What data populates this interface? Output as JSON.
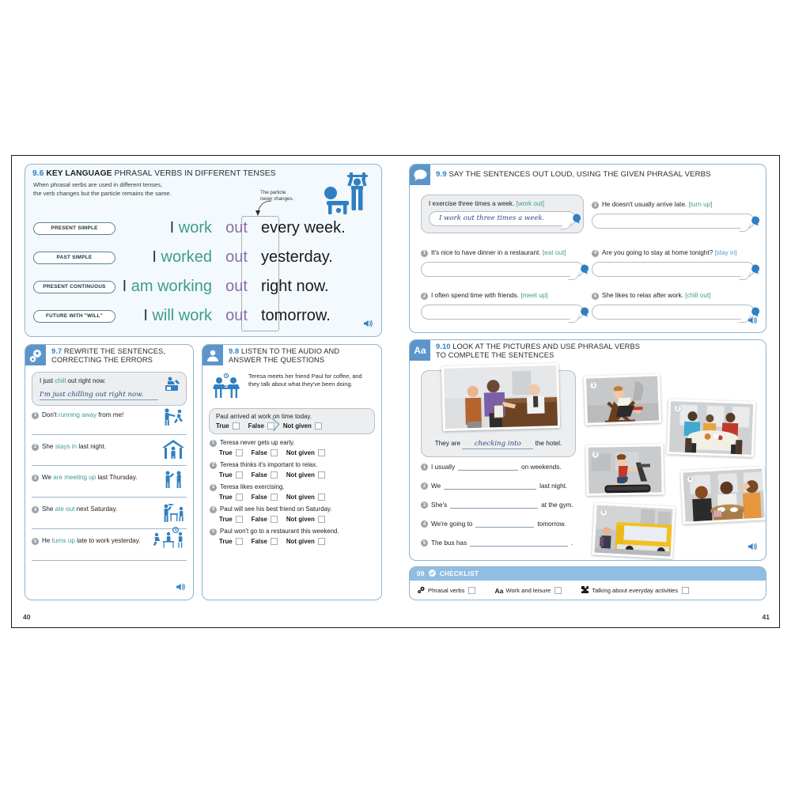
{
  "book": {
    "page_left": "40",
    "page_right": "41",
    "accent_blue": "#5b95c9",
    "verb_green": "#3f9c8d",
    "particle_purple": "#8b6fa8",
    "heading_blue": "#2f7fc0"
  },
  "key_language": {
    "number": "9.6",
    "label": "KEY LANGUAGE",
    "title": "PHRASAL VERBS IN DIFFERENT TENSES",
    "subtitle_line1": "When phrasal verbs are used in different tenses,",
    "subtitle_line2": "the verb changes but the particle remains the same.",
    "particle_note_line1": "The particle",
    "particle_note_line2": "never changes.",
    "icon": "weightlifter-icon",
    "audio_icon": "speaker-icon",
    "rows": [
      {
        "tense": "PRESENT SIMPLE",
        "subject": "I",
        "verb": "work",
        "particle": "out",
        "rest": "every week."
      },
      {
        "tense": "PAST SIMPLE",
        "subject": "I",
        "verb": "worked",
        "particle": "out",
        "rest": "yesterday."
      },
      {
        "tense": "PRESENT CONTINUOUS",
        "subject": "I",
        "verb": "am working",
        "particle": "out",
        "rest": "right now."
      },
      {
        "tense": "FUTURE WITH \"WILL\"",
        "subject": "I",
        "verb": "will work",
        "particle": "out",
        "rest": "tomorrow."
      }
    ]
  },
  "ex_97": {
    "number": "9.7",
    "title_line1": "REWRITE THE SENTENCES,",
    "title_line2": "CORRECTING THE ERRORS",
    "icon": "gears-icon",
    "audio_icon": "speaker-icon",
    "example": {
      "prompt_pre": "I just ",
      "prompt_hl": "chill",
      "prompt_post": " out right now.",
      "answer": "I'm just chilling out right now.",
      "icon": "person-relaxing-icon"
    },
    "items": [
      {
        "n": "1",
        "pre": "Don't ",
        "hl": "running away",
        "post": " from me!",
        "icon": "person-running-away-icon"
      },
      {
        "n": "2",
        "pre": "She ",
        "hl": "stays in",
        "post": " last night.",
        "icon": "house-person-icon"
      },
      {
        "n": "3",
        "pre": "We ",
        "hl": "are meeting up",
        "post": " last Thursday.",
        "icon": "two-people-waving-icon"
      },
      {
        "n": "4",
        "pre": "She ",
        "hl": "ate out",
        "post": " next Saturday.",
        "icon": "restaurant-waiter-icon"
      },
      {
        "n": "5",
        "pre": "He ",
        "hl": "turns up",
        "post": " late to work yesterday.",
        "icon": "office-clock-icon"
      }
    ]
  },
  "ex_98": {
    "number": "9.8",
    "title_line1": "LISTEN TO THE AUDIO AND",
    "title_line2": "ANSWER THE QUESTIONS",
    "icon": "headphones-icon",
    "intro_icon": "two-people-at-table-icon",
    "intro": "Teresa meets her friend Paul for coffee, and they talk about what they've been doing.",
    "choices": [
      "True",
      "False",
      "Not given"
    ],
    "example": {
      "question": "Paul arrived at work on time today.",
      "checked_index": 1
    },
    "items": [
      {
        "n": "1",
        "question": "Teresa never gets up early."
      },
      {
        "n": "2",
        "question": "Teresa thinks it's important to relax."
      },
      {
        "n": "3",
        "question": "Teresa likes exercising."
      },
      {
        "n": "4",
        "question": "Paul will see his best friend on Saturday."
      },
      {
        "n": "5",
        "question": "Paul won't go to a restaurant this weekend."
      }
    ]
  },
  "ex_99": {
    "number": "9.9",
    "title": "SAY THE SENTENCES OUT LOUD, USING THE GIVEN PHRASAL VERBS",
    "icon": "speech-bubble-icon",
    "audio_icon": "speaker-icon",
    "example": {
      "prompt": "I exercise three times a week.",
      "verb": "[work out]",
      "answer": "I work out three times a week."
    },
    "items": [
      {
        "n": "1",
        "prompt": "It's nice to have dinner in a restaurant.",
        "verb": "[eat out]"
      },
      {
        "n": "2",
        "prompt": "I often spend time with friends.",
        "verb": "[meet up]"
      },
      {
        "n": "3",
        "prompt": "He doesn't usually arrive late.",
        "verb": "[turn up]"
      },
      {
        "n": "4",
        "prompt": "Are you going to stay at home tonight?",
        "verb": "[stay in]"
      },
      {
        "n": "5",
        "prompt": "She likes to relax after work.",
        "verb": "[chill out]"
      }
    ]
  },
  "ex_910": {
    "number": "9.10",
    "badge": "Aa",
    "title_line1": "LOOK AT THE PICTURES AND USE PHRASAL VERBS",
    "title_line2": "TO COMPLETE THE SENTENCES",
    "icon": "aa-badge-icon",
    "audio_icon": "speaker-icon",
    "example": {
      "pre": "They are",
      "answer": "checking into",
      "post": "the hotel.",
      "photo": "hotel-reception-photo"
    },
    "items": [
      {
        "n": "1",
        "pre": "I usually",
        "post": "on  weekends.",
        "photo": "person-in-deckchair-photo"
      },
      {
        "n": "2",
        "pre": "We",
        "post": "last night.",
        "photo": "family-dinner-photo"
      },
      {
        "n": "3",
        "pre": "She's",
        "post": "at the gym.",
        "photo": "treadmill-runner-photo"
      },
      {
        "n": "4",
        "pre": "We're going to",
        "post": "tomorrow.",
        "photo": "friends-at-cafe-photo"
      },
      {
        "n": "5",
        "pre": "The bus has",
        "post": ".",
        "photo": "yellow-bus-photo"
      }
    ]
  },
  "checklist": {
    "unit": "09",
    "label": "CHECKLIST",
    "check_icon": "check-circle-icon",
    "items": [
      {
        "icon": "gears-icon",
        "label": "Phrasal verbs"
      },
      {
        "icon": "aa-icon",
        "label": "Work and leisure"
      },
      {
        "icon": "puzzle-icon",
        "label": "Talking about everyday activities"
      }
    ]
  }
}
